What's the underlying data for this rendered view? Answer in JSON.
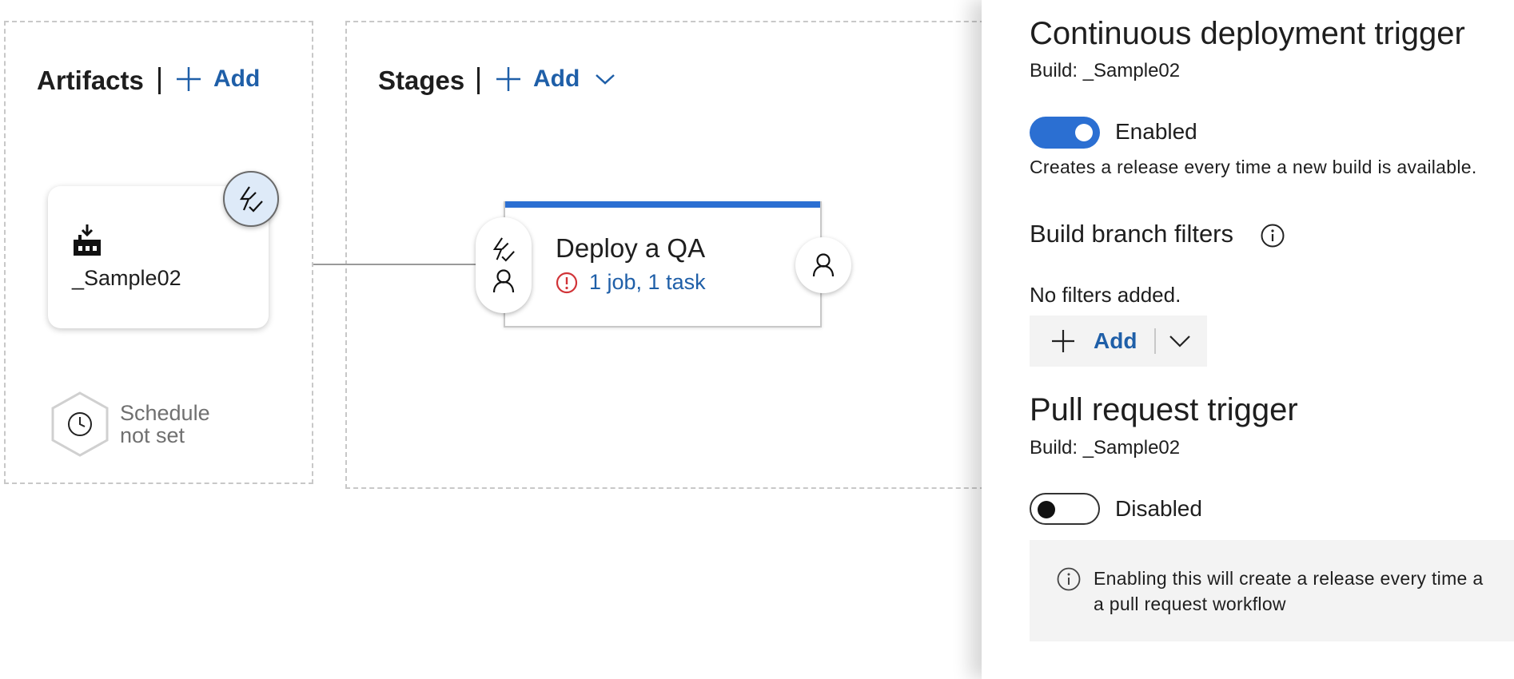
{
  "canvas": {
    "artifacts": {
      "title": "Artifacts",
      "add_label": "Add",
      "artifact": {
        "name": "_Sample02",
        "icon": "build-artifact-icon"
      },
      "trigger_icon": "lightning-check-icon",
      "schedule": {
        "line1": "Schedule",
        "line2": "not set",
        "icon": "clock-icon"
      }
    },
    "stages": {
      "title": "Stages",
      "add_label": "Add",
      "stage": {
        "name": "Deploy a QA",
        "tasks": "1 job, 1 task",
        "status_icon": "warning-circle-icon"
      }
    }
  },
  "panel": {
    "cd_trigger": {
      "title": "Continuous deployment trigger",
      "build": "Build: _Sample02",
      "toggle_state": "on",
      "toggle_label": "Enabled",
      "description": "Creates a release every time a new build is available."
    },
    "branch_filters": {
      "title": "Build branch filters",
      "empty_text": "No filters added.",
      "add_label": "Add"
    },
    "pr_trigger": {
      "title": "Pull request trigger",
      "build": "Build: _Sample02",
      "toggle_state": "off",
      "toggle_label": "Disabled",
      "info_line1": "Enabling this will create a release every time a",
      "info_line2": "a pull request workflow"
    }
  },
  "colors": {
    "accent": "#2b6fd2",
    "link": "#1f5fa8",
    "warning": "#d13438",
    "panel_bg_gray": "#f3f3f3"
  }
}
